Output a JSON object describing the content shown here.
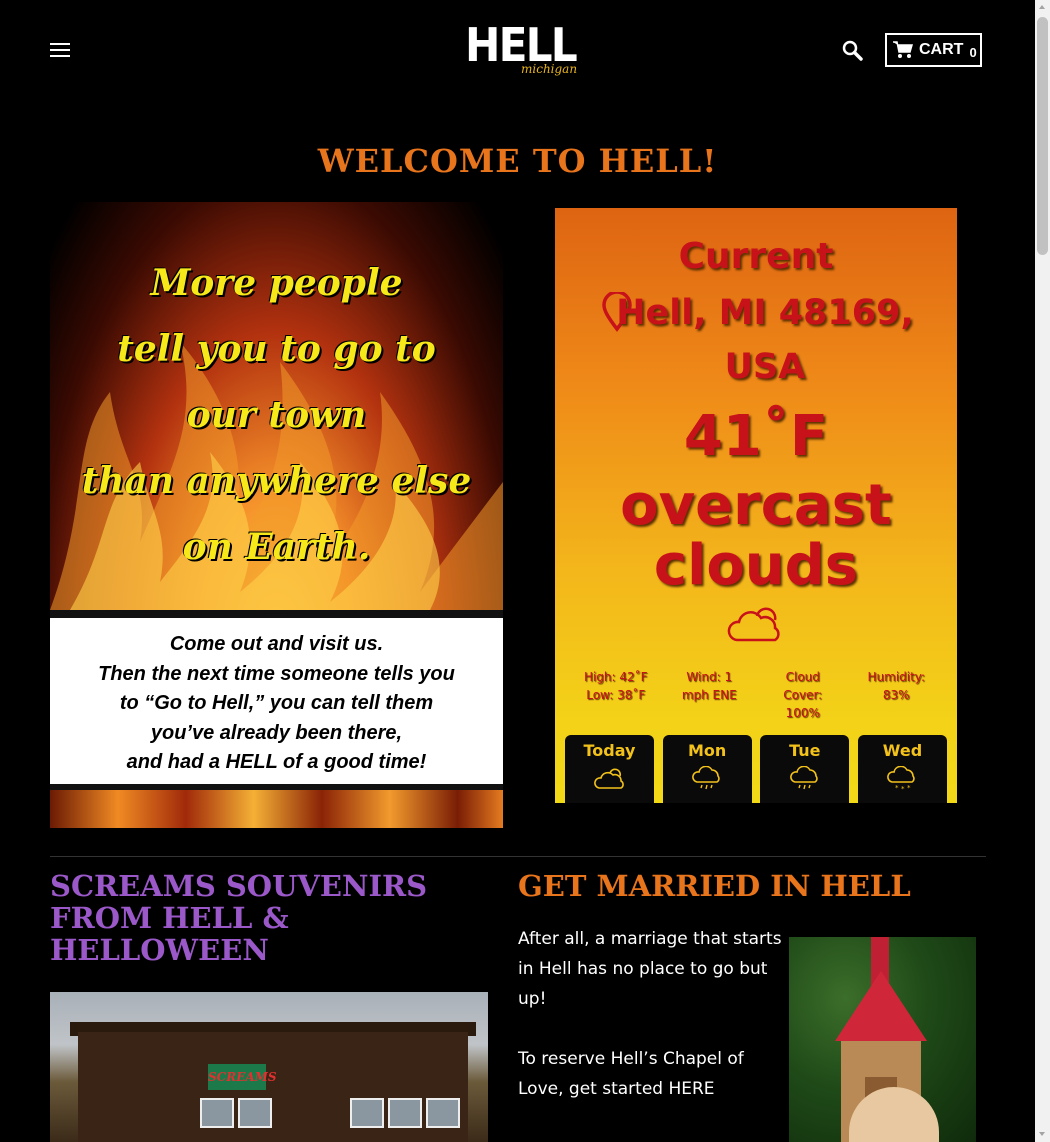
{
  "header": {
    "logo_main": "HELL",
    "logo_sub": "michigan",
    "cart_label": "CART",
    "cart_count": "0"
  },
  "welcome_title": "WELCOME TO HELL!",
  "hero": {
    "line1": "More people",
    "line2": "tell you to go to",
    "line3": "our town",
    "line4": "than anywhere else",
    "line5": "on Earth.",
    "sub1": "Come out and visit us.",
    "sub2": "Then the next time someone tells you",
    "sub3": "to “Go to Hell,” you can tell them",
    "sub4": "you’ve already been there,",
    "sub5": "and had a HELL of a good time!"
  },
  "weather": {
    "title": "Current",
    "location": "Hell, MI 48169, USA",
    "temp": "41˚F",
    "condition": "overcast clouds",
    "high": "High: 42˚F",
    "low": "Low: 38˚F",
    "wind": "Wind: 1 mph ENE",
    "cloud_cover": "Cloud Cover: 100%",
    "humidity": "Humidity: 83%",
    "days": [
      {
        "name": "Today",
        "icon": "partly-cloudy-icon"
      },
      {
        "name": "Mon",
        "icon": "rain-cloud-icon"
      },
      {
        "name": "Tue",
        "icon": "rain-cloud-icon"
      },
      {
        "name": "Wed",
        "icon": "snow-cloud-icon"
      }
    ],
    "colors": {
      "text": "#c8121a",
      "day_text": "#f3c21a"
    }
  },
  "screams": {
    "title": "SCREAMS SOUVENIRS FROM HELL & HELLOWEEN",
    "sign_text": "SCREAMS"
  },
  "married": {
    "title": "GET MARRIED IN HELL",
    "p1": "After all, a marriage that starts in Hell has no place to go but up!",
    "p2": "To reserve Hell’s Chapel of Love, get started HERE"
  },
  "colors": {
    "accent_orange": "#e8741c",
    "accent_purple": "#9a58c9",
    "background": "#000000"
  }
}
